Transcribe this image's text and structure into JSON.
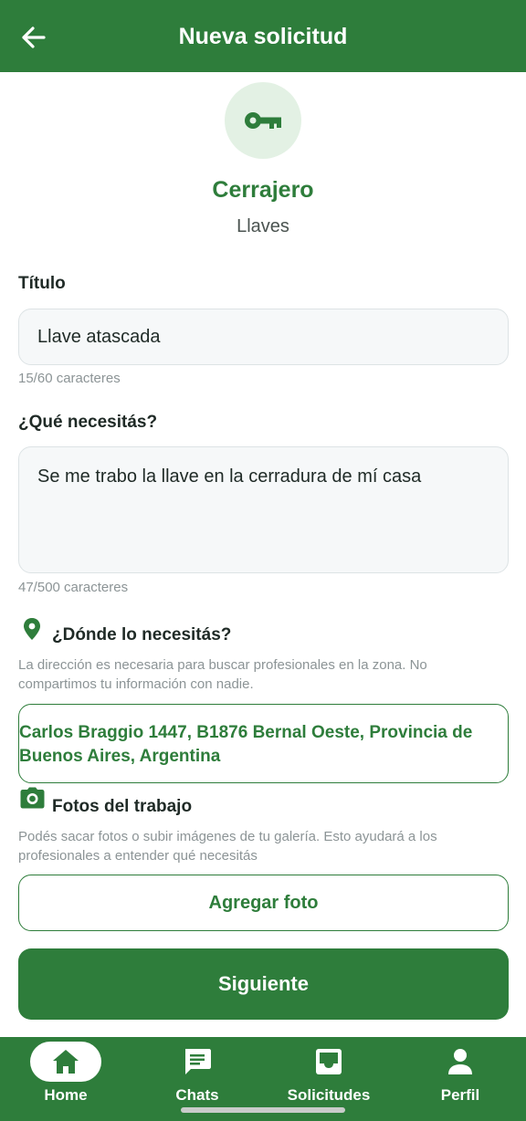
{
  "appbar": {
    "title": "Nueva solicitud",
    "back_icon": "arrow-left-icon"
  },
  "category": {
    "icon": "key-icon",
    "name": "Cerrajero",
    "subcategory": "Llaves"
  },
  "form": {
    "title_label": "Título",
    "title_value": "Llave atascada",
    "title_counter": "15/60 caracteres",
    "need_label": "¿Qué necesitás?",
    "need_value": "Se me trabo la llave en la cerradura de mí casa",
    "need_counter": "47/500 caracteres",
    "location_label": "¿Dónde lo necesitás?",
    "location_icon": "map-pin-icon",
    "location_help": "La dirección es necesaria para buscar profesionales en la zona. No compartimos tu información con nadie.",
    "address": "Carlos Braggio 1447, B1876 Bernal Oeste, Provincia de Buenos Aires, Argentina",
    "photos_label": "Fotos del trabajo",
    "photos_icon": "camera-icon",
    "photos_help": "Podés sacar fotos o subir imágenes de tu galería. Esto ayudará a los profesionales a entender qué necesitás",
    "add_photo_label": "Agregar foto",
    "next_label": "Siguiente"
  },
  "bottom_nav": [
    {
      "label": "Home",
      "icon": "home-icon",
      "active": true
    },
    {
      "label": "Chats",
      "icon": "chat-icon",
      "active": false
    },
    {
      "label": "Solicitudes",
      "icon": "inbox-icon",
      "active": false
    },
    {
      "label": "Perfil",
      "icon": "person-icon",
      "active": false
    }
  ],
  "colors": {
    "primary": "#2e7d3b",
    "accent_light": "#e3f1e4",
    "muted": "#8c9496"
  }
}
